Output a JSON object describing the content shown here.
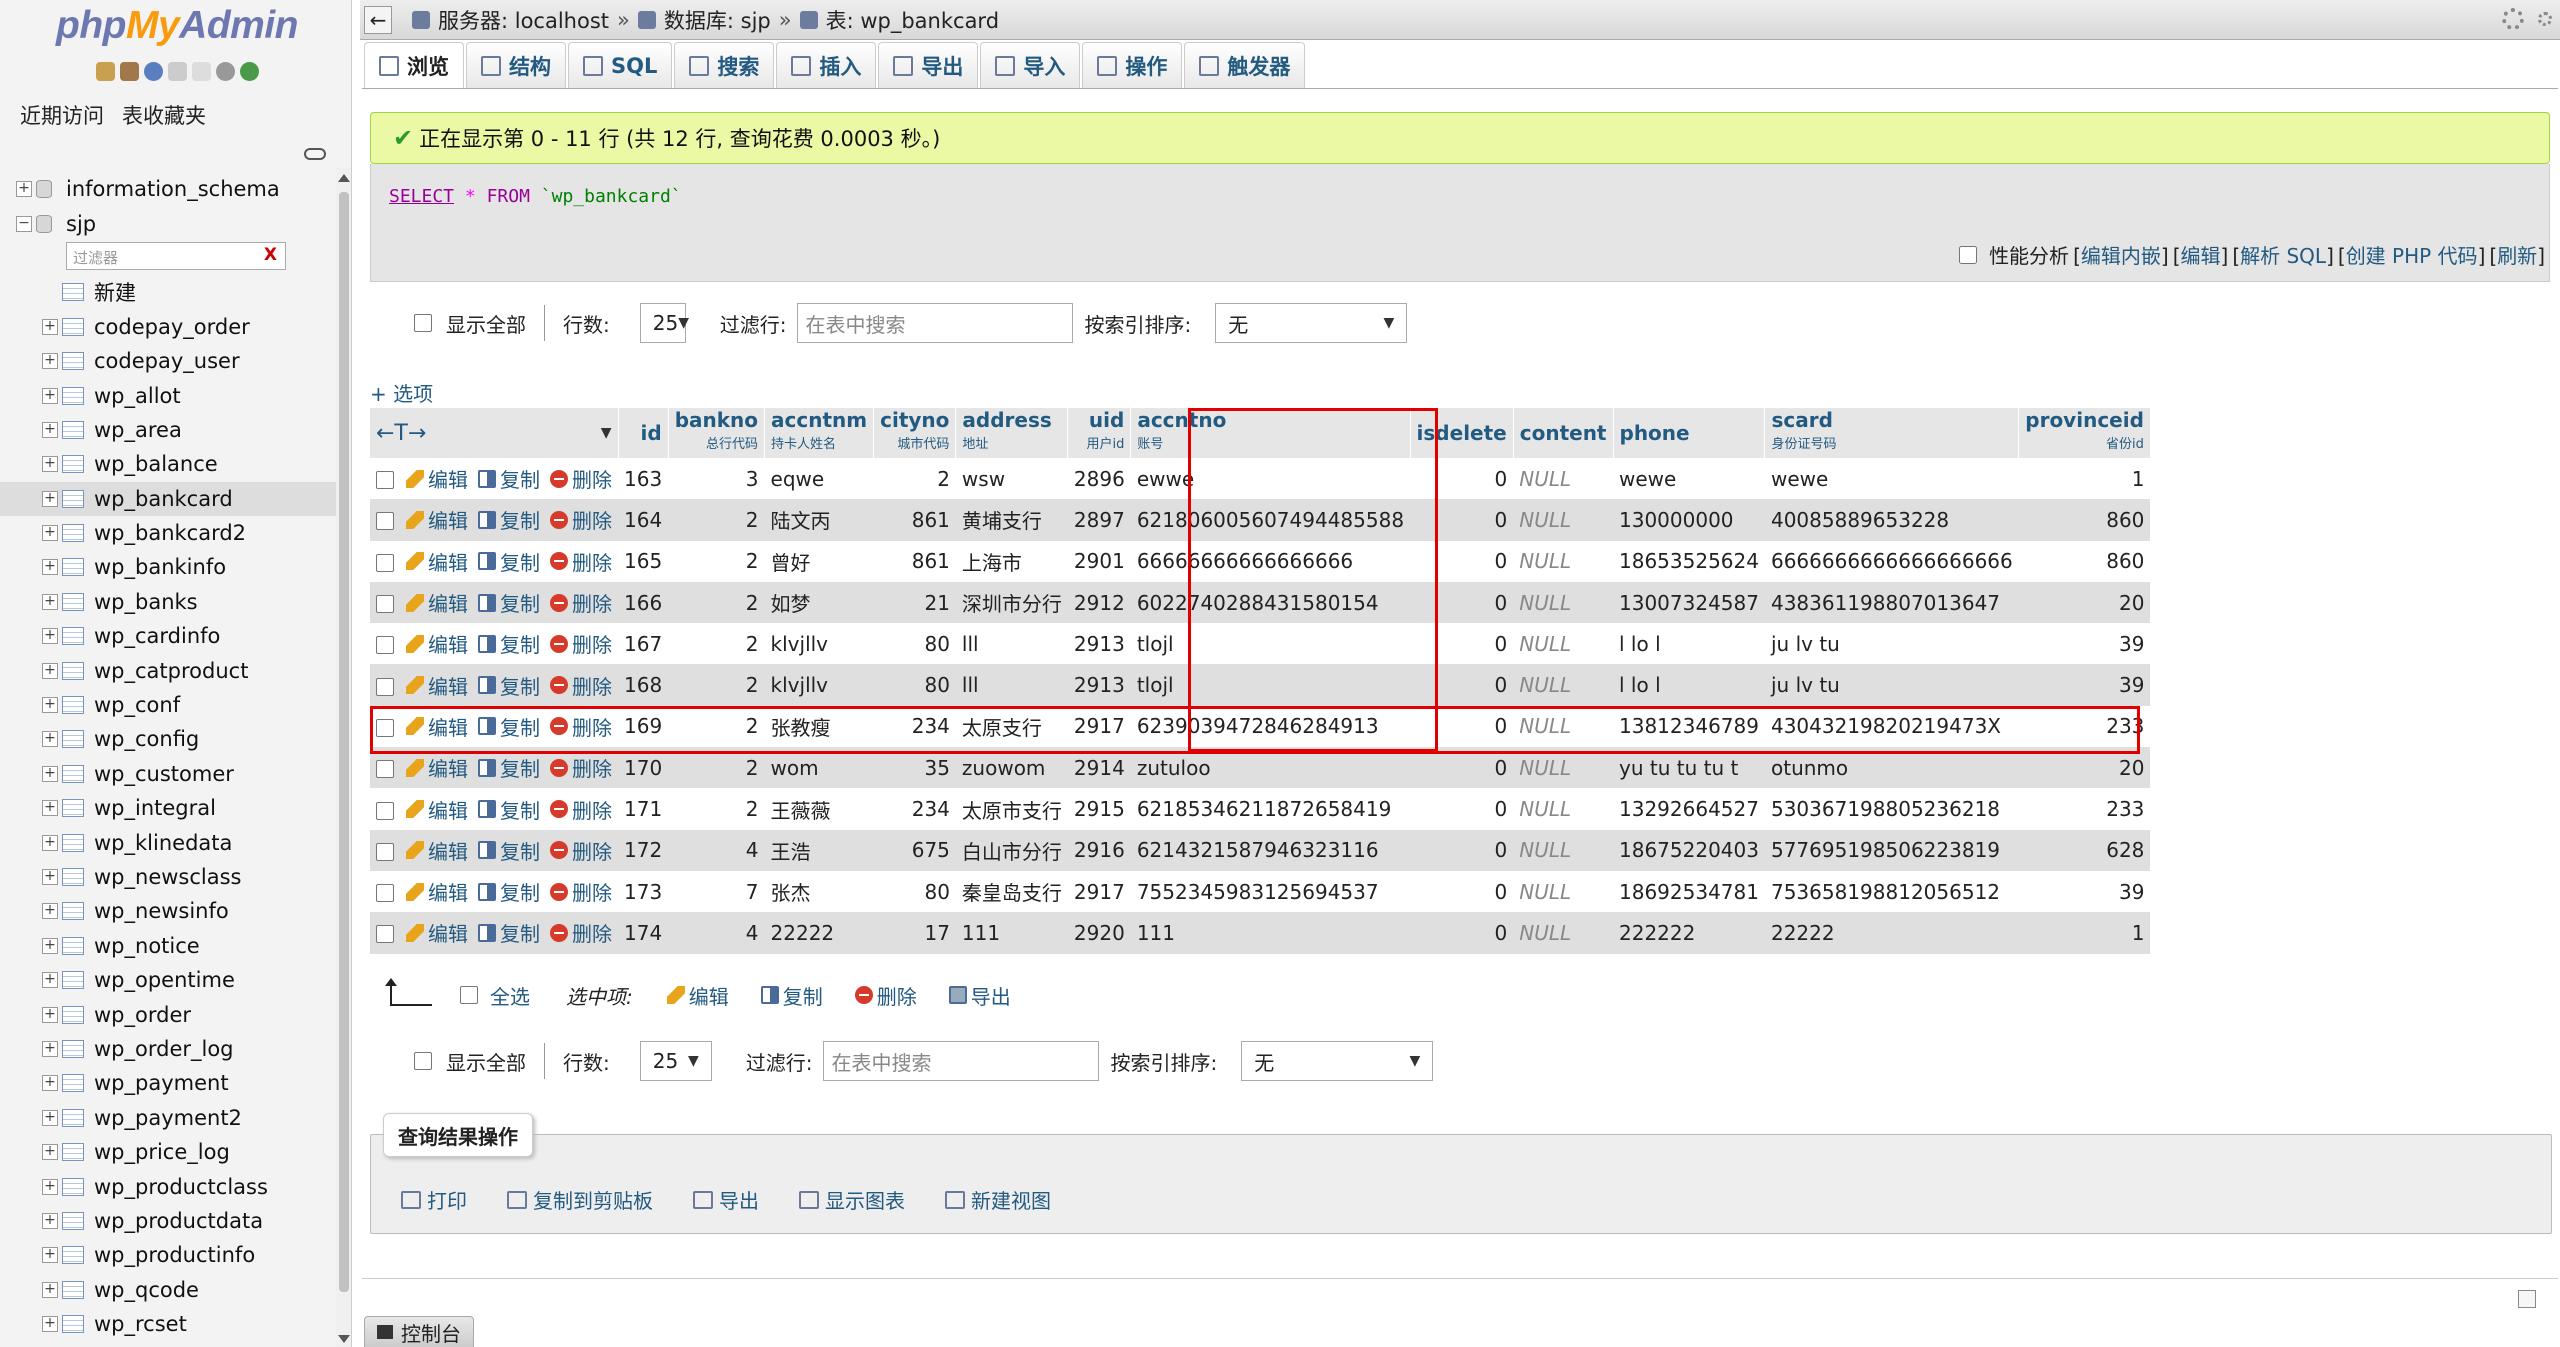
{
  "nav": {
    "logo_php": "php",
    "logo_my": "My",
    "logo_admin": "Admin",
    "tabs": [
      "近期访问",
      "表收藏夹"
    ],
    "databases": [
      {
        "name": "information_schema",
        "expanded": false
      },
      {
        "name": "sjp",
        "expanded": true
      }
    ],
    "filter_placeholder": "过滤器",
    "filter_clear": "X",
    "new_label": "新建",
    "tables": [
      "codepay_order",
      "codepay_user",
      "wp_allot",
      "wp_area",
      "wp_balance",
      "wp_bankcard",
      "wp_bankcard2",
      "wp_bankinfo",
      "wp_banks",
      "wp_cardinfo",
      "wp_catproduct",
      "wp_conf",
      "wp_config",
      "wp_customer",
      "wp_integral",
      "wp_klinedata",
      "wp_newsclass",
      "wp_newsinfo",
      "wp_notice",
      "wp_opentime",
      "wp_order",
      "wp_order_log",
      "wp_payment",
      "wp_payment2",
      "wp_price_log",
      "wp_productclass",
      "wp_productdata",
      "wp_productinfo",
      "wp_qcode",
      "wp_rcset"
    ],
    "selected_table": "wp_bankcard"
  },
  "breadcrumb": {
    "server": "服务器: localhost",
    "database": "数据库: sjp",
    "table": "表: wp_bankcard",
    "sep": "»"
  },
  "tabs": [
    "浏览",
    "结构",
    "SQL",
    "搜索",
    "插入",
    "导出",
    "导入",
    "操作",
    "触发器"
  ],
  "success": "正在显示第 0 - 11 行 (共 12 行, 查询花费 0.0003 秒。)",
  "sql": {
    "select": "SELECT",
    "star": "*",
    "from": "FROM",
    "table": "`wp_bankcard`"
  },
  "sql_links": {
    "profiling": "性能分析",
    "links": [
      "编辑内嵌",
      "编辑",
      "解析 SQL",
      "创建 PHP 代码",
      "刷新"
    ]
  },
  "controls": {
    "show_all": "显示全部",
    "rows_label": "行数:",
    "rows_value": "25",
    "filter_label": "过滤行:",
    "filter_placeholder": "在表中搜索",
    "sort_label": "按索引排序:",
    "sort_value": "无"
  },
  "options_link": "+ 选项",
  "header_arrows": "←T→",
  "columns": [
    {
      "name": "id",
      "comment": "",
      "align": "right"
    },
    {
      "name": "bankno",
      "comment": "总行代码",
      "align": "right"
    },
    {
      "name": "accntnm",
      "comment": "持卡人姓名",
      "align": "left"
    },
    {
      "name": "cityno",
      "comment": "城市代码",
      "align": "right"
    },
    {
      "name": "address",
      "comment": "地址",
      "align": "left"
    },
    {
      "name": "uid",
      "comment": "用户id",
      "align": "right"
    },
    {
      "name": "accntno",
      "comment": "账号",
      "align": "left"
    },
    {
      "name": "isdelete",
      "comment": "",
      "align": "right"
    },
    {
      "name": "content",
      "comment": "",
      "align": "left"
    },
    {
      "name": "phone",
      "comment": "",
      "align": "left"
    },
    {
      "name": "scard",
      "comment": "身份证号码",
      "align": "left"
    },
    {
      "name": "provinceid",
      "comment": "省份id",
      "align": "right"
    }
  ],
  "row_actions": {
    "edit": "编辑",
    "copy": "复制",
    "delete": "删除"
  },
  "rows": [
    [
      "163",
      "3",
      "eqwe",
      "2",
      "wsw",
      "2896",
      "ewwe",
      "0",
      "NULL",
      "wewe",
      "wewe",
      "1"
    ],
    [
      "164",
      "2",
      "陆文丙",
      "861",
      "黄埔支行",
      "2897",
      "6218060056074944855​88",
      "0",
      "NULL",
      "130000000",
      "40085889653228",
      "860"
    ],
    [
      "165",
      "2",
      "曾好",
      "861",
      "上海市",
      "2901",
      "6666666666666666​6",
      "0",
      "NULL",
      "18653525624",
      "6666666666666666666",
      "860"
    ],
    [
      "166",
      "2",
      "如梦",
      "21",
      "深圳市分行",
      "2912",
      "6022740288431580154",
      "0",
      "NULL",
      "13007324587",
      "438361198807013647",
      "20"
    ],
    [
      "167",
      "2",
      "klvjllv",
      "80",
      "lll",
      "2913",
      "tlojl",
      "0",
      "NULL",
      "l lo l",
      "ju lv tu",
      "39"
    ],
    [
      "168",
      "2",
      "klvjllv",
      "80",
      "lll",
      "2913",
      "tlojl",
      "0",
      "NULL",
      "l lo l",
      "ju lv tu",
      "39"
    ],
    [
      "169",
      "2",
      "张教瘦",
      "234",
      "太原支行",
      "2917",
      "6239039472846284913",
      "0",
      "NULL",
      "13812346789",
      "43043219820219473X",
      "233"
    ],
    [
      "170",
      "2",
      "wom",
      "35",
      "zuowom",
      "2914",
      "zutuloo",
      "0",
      "NULL",
      "yu tu tu tu t",
      "otunmo",
      "20"
    ],
    [
      "171",
      "2",
      "王薇薇",
      "234",
      "太原市支行",
      "2915",
      "6218534621187265​8419",
      "0",
      "NULL",
      "13292664527",
      "530367198805236218",
      "233"
    ],
    [
      "172",
      "4",
      "王浩",
      "675",
      "白山市分行",
      "2916",
      "6214321587946323116",
      "0",
      "NULL",
      "18675220403",
      "577695198506223819",
      "628"
    ],
    [
      "173",
      "7",
      "张杰",
      "80",
      "秦皇岛支行",
      "2917",
      "7552345983125694537",
      "0",
      "NULL",
      "18692534781",
      "753658198812056512",
      "39"
    ],
    [
      "174",
      "4",
      "22222",
      "17",
      "111",
      "2920",
      "111",
      "0",
      "NULL",
      "222222",
      "22222",
      "1"
    ]
  ],
  "with_selected": {
    "check_all": "全选",
    "label": "选中项:",
    "edit": "编辑",
    "copy": "复制",
    "delete": "删除",
    "export": "导出"
  },
  "query_results": {
    "legend": "查询结果操作",
    "ops": [
      "打印",
      "复制到剪贴板",
      "导出",
      "显示图表",
      "新建视图"
    ]
  },
  "console": "控制台",
  "colors": {
    "highlight": "#e00000",
    "link": "#235a81",
    "success_bg": "#ebf8a4"
  }
}
